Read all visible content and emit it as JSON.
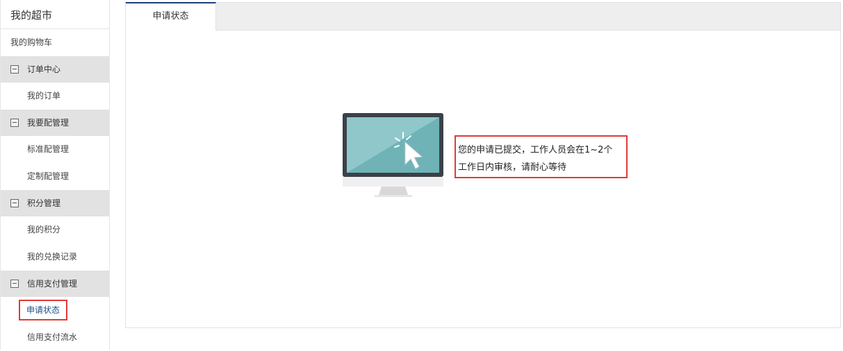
{
  "sidebar": {
    "title": "我的超市",
    "cart": "我的购物车",
    "groups": [
      {
        "label": "订单中心",
        "items": [
          "我的订单"
        ]
      },
      {
        "label": "我要配管理",
        "items": [
          "标准配管理",
          "定制配管理"
        ]
      },
      {
        "label": "积分管理",
        "items": [
          "我的积分",
          "我的兑换记录"
        ]
      },
      {
        "label": "信用支付管理",
        "items": [
          "申请状态",
          "信用支付流水"
        ]
      }
    ]
  },
  "main": {
    "tab_label": "申请状态",
    "message_line1": "您的申请已提交，工作人员会在1~2个",
    "message_line2": "工作日内审核，请耐心等待"
  },
  "colors": {
    "active_tab_border": "#1b3f7a",
    "highlight_red": "#e03a3a",
    "group_bg": "#e2e2e2",
    "screen_teal": "#7fc1c5"
  },
  "icons": {
    "group_toggle": "minus-icon",
    "illustration": "monitor-cursor-icon"
  }
}
